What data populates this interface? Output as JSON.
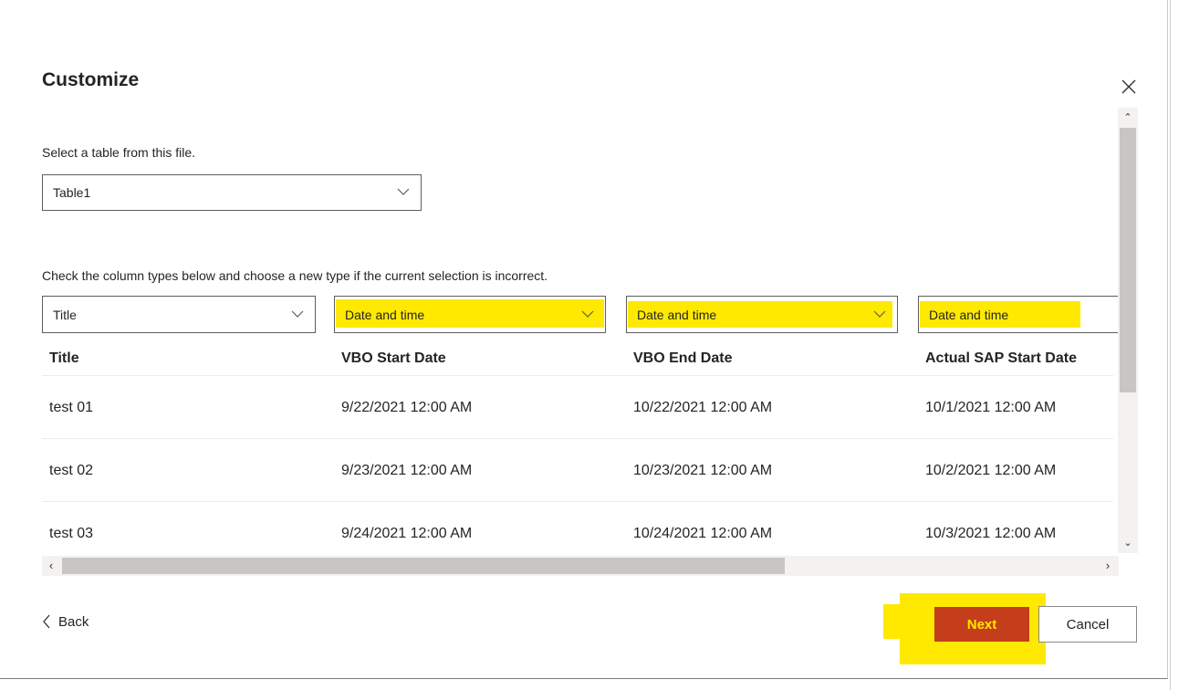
{
  "dialog": {
    "title": "Customize",
    "close_icon": "close-icon",
    "table_prompt": "Select a table from this file.",
    "table_select": {
      "value": "Table1"
    },
    "columns_prompt": "Check the column types below and choose a new type if the current selection is incorrect."
  },
  "column_types": [
    "Title",
    "Date and time",
    "Date and time",
    "Date and time"
  ],
  "table": {
    "headers": [
      "Title",
      "VBO Start Date",
      "VBO End Date",
      "Actual SAP Start Date"
    ],
    "rows": [
      [
        "test 01",
        "9/22/2021 12:00 AM",
        "10/22/2021 12:00 AM",
        "10/1/2021 12:00 AM"
      ],
      [
        "test 02",
        "9/23/2021 12:00 AM",
        "10/23/2021 12:00 AM",
        "10/2/2021 12:00 AM"
      ],
      [
        "test 03",
        "9/24/2021 12:00 AM",
        "10/24/2021 12:00 AM",
        "10/3/2021 12:00 AM"
      ]
    ]
  },
  "footer": {
    "back_label": "Back",
    "next_label": "Next",
    "cancel_label": "Cancel"
  },
  "colors": {
    "primary_button": "#c43e1c",
    "highlight": "#ffe900"
  }
}
